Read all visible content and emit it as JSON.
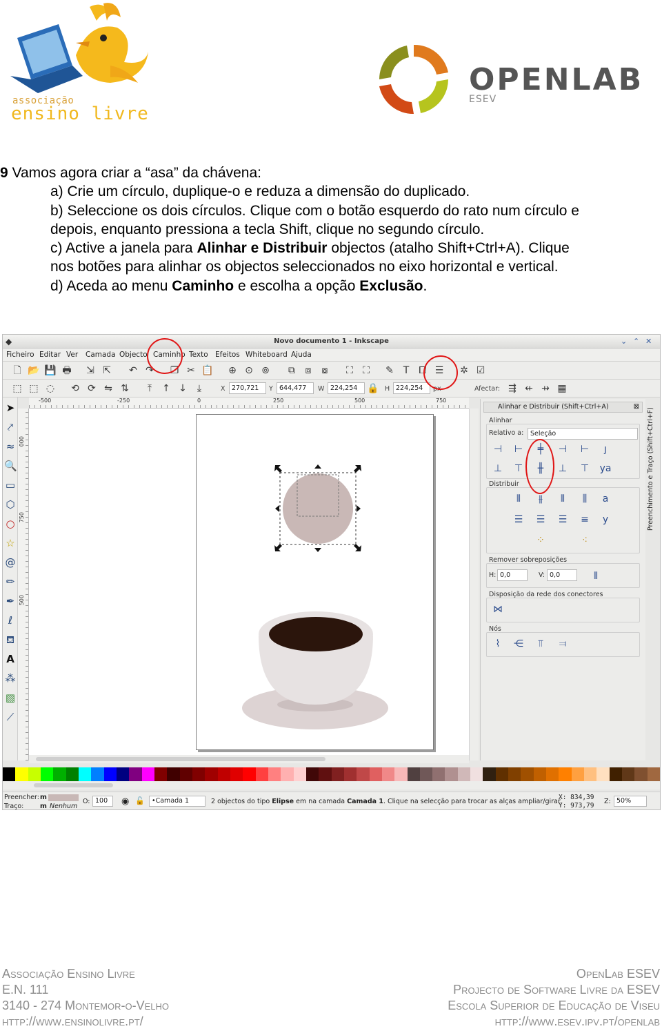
{
  "header": {
    "left_logo": {
      "line1": "associação",
      "line2": "ensino livre"
    },
    "right_logo": {
      "brand": "OPENLAB",
      "sub": "ESEV"
    }
  },
  "instructions": {
    "number": "9",
    "title": " Vamos agora criar a “asa”  da chávena:",
    "item_a": "a) Crie um círculo, duplique-o e reduza a dimensão do duplicado.",
    "item_b1": "b) Seleccione os dois círculos. Clique com o botão esquerdo do rato num círculo e",
    "item_b2": "depois, enquanto pressiona a tecla Shift, clique no segundo círculo.",
    "item_c_pre": "c) Active a janela para ",
    "item_c_bold": "Alinhar e Distribuir",
    "item_c_post": " objectos (atalho Shift+Ctrl+A). Clique",
    "item_c2": "nos botões para alinhar os objectos seleccionados no eixo horizontal e vertical.",
    "item_d_pre": "d) Aceda ao menu ",
    "item_d_bold1": "Caminho",
    "item_d_mid": " e escolha a opção ",
    "item_d_bold2": "Exclusão",
    "item_d_post": "."
  },
  "inkscape": {
    "window_title": "Novo documento 1 - Inkscape",
    "menu": [
      "Ficheiro",
      "Editar",
      "Ver",
      "Camada",
      "Objecto",
      "Caminho",
      "Texto",
      "Efeitos",
      "Whiteboard",
      "Ajuda"
    ],
    "toolbar": {
      "x_label": "X",
      "x_value": "270,721",
      "y_label": "Y",
      "y_value": "644,477",
      "w_label": "W",
      "w_value": "224,254",
      "h_label": "H",
      "h_value": "224,254",
      "unit": "px",
      "affect_label": "Afectar:"
    },
    "ruler_labels": [
      "-500",
      "-250",
      "0",
      "250",
      "500",
      "750"
    ],
    "vruler_labels": [
      "000",
      "750",
      "500"
    ],
    "panel": {
      "title": "Alinhar e Distribuir (Shift+Ctrl+A)",
      "align_label": "Alinhar",
      "relative_label": "Relativo a:",
      "relative_value": "Seleção",
      "distribute_label": "Distribuir",
      "remove_overlap_label": "Remover sobreposições",
      "h_label": "H:",
      "h_value": "0,0",
      "v_label": "V:",
      "v_value": "0,0",
      "connector_label": "Disposição da rede dos conectores",
      "nodes_label": "Nós",
      "side_tab": "Preenchimento e Traço (Shift+Ctrl+F)"
    },
    "palette_colors": [
      "#000000",
      "#ffff00",
      "#c8ff00",
      "#00ff00",
      "#00b000",
      "#008000",
      "#00ffff",
      "#0080ff",
      "#0000ff",
      "#000080",
      "#800080",
      "#ff00ff",
      "#800000",
      "#400000",
      "#600000",
      "#800000",
      "#a00000",
      "#c00000",
      "#e00000",
      "#ff0000",
      "#ff4040",
      "#ff8080",
      "#ffb0b0",
      "#ffd0d0",
      "#400808",
      "#601010",
      "#802020",
      "#a03030",
      "#c04848",
      "#e06060",
      "#f08888",
      "#f8b8b8",
      "#504040",
      "#705858",
      "#907070",
      "#b09090",
      "#d0b8b8",
      "#f0e0e0",
      "#302010",
      "#603000",
      "#804000",
      "#a05000",
      "#c06000",
      "#e07000",
      "#ff8000",
      "#ffa040",
      "#ffc080",
      "#ffe0c0",
      "#402000",
      "#603818",
      "#805030",
      "#a06840"
    ],
    "status": {
      "fill_label": "Preencher:",
      "fill_value": "m",
      "stroke_label": "Traço:",
      "stroke_value": "m",
      "stroke_none": "Nenhum",
      "opacity_label": "O:",
      "opacity_value": "100",
      "layer_value": "•Camada 1",
      "message_pre": "2 objectos do tipo ",
      "message_bold": "Elipse",
      "message_mid": " em na camada ",
      "message_bold2": "Camada 1",
      "message_post": ". Clique na selecção para trocar as alças ampliar/girar.",
      "x_coord": "X: 834,39",
      "y_coord": "Y: 973,79",
      "zoom_label": "Z:",
      "zoom_value": "50%"
    }
  },
  "footer": {
    "left": [
      "Associação Ensino Livre",
      "E.N. 111",
      "3140 - 274 Montemor-o-Velho",
      "http://www.ensinolivre.pt/"
    ],
    "right": [
      "OpenLab ESEV",
      "Projecto de Software Livre da ESEV",
      "Escola Superior de Educação de Viseu",
      "http://www.esev.ipv.pt/openlab"
    ]
  }
}
